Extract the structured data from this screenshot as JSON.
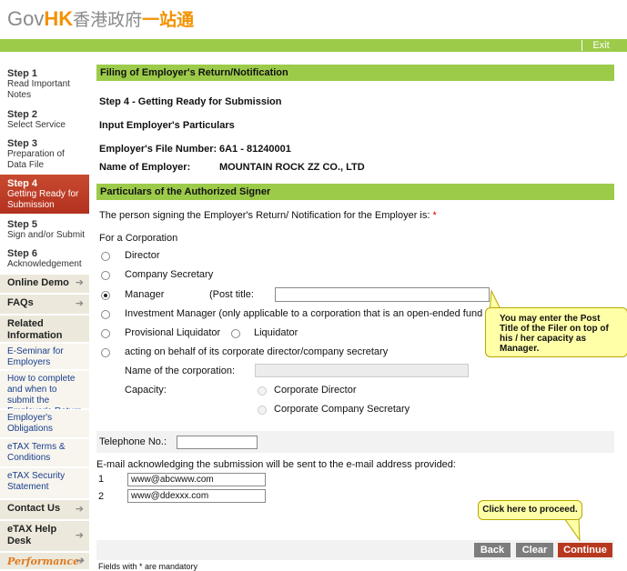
{
  "header": {
    "logo_gov": "Gov",
    "logo_hk": "HK",
    "logo_zh_grey": "香港政府",
    "logo_zh_orange": "一站通",
    "exit_label": "Exit"
  },
  "sidebar": {
    "steps": [
      {
        "num": "Step 1",
        "label": "Read Important Notes"
      },
      {
        "num": "Step 2",
        "label": "Select Service"
      },
      {
        "num": "Step 3",
        "label": "Preparation of Data File"
      },
      {
        "num": "Step 4",
        "label": "Getting Ready for Submission"
      },
      {
        "num": "Step 5",
        "label": "Sign and/or Submit"
      },
      {
        "num": "Step 6",
        "label": "Acknowledgement"
      }
    ],
    "online_demo": "Online Demo",
    "faqs": "FAQs",
    "related_information": "Related Information",
    "links": [
      "E-Seminar for Employers",
      "How to complete and when to submit the Employer's Return",
      "Employer's Obligations",
      "eTAX Terms & Conditions",
      "eTAX Security Statement"
    ],
    "contact_us": "Contact Us",
    "etax_help": "eTAX Help Desk",
    "performance": "Performance"
  },
  "main": {
    "section_title": "Filing of Employer's Return/Notification",
    "step_heading": "Step 4 - Getting Ready for Submission",
    "input_heading": "Input Employer's Particulars",
    "file_number_label": "Employer's File Number:",
    "file_number_value": "6A1 - 81240001",
    "employer_name_label": "Name of Employer:",
    "employer_name_value": "MOUNTAIN ROCK ZZ CO., LTD",
    "signer_section_title": "Particulars of the Authorized Signer",
    "signer_intro": "The person signing the Employer's Return/ Notification for the Employer is:",
    "required_mark": "*",
    "for_corporation": "For a Corporation",
    "options": {
      "director": "Director",
      "company_secretary": "Company Secretary",
      "manager": "Manager",
      "post_title_label": "(Post title:",
      "post_title_value": "",
      "investment_manager": "Investment Manager (only applicable to a corporation that is an open-ended fund co",
      "provisional_liquidator": "Provisional Liquidator",
      "liquidator": "Liquidator",
      "acting_on_behalf": "acting on behalf of its corporate director/company secretary",
      "selected": "manager"
    },
    "corporation_name_label": "Name of the corporation:",
    "corporation_name_value": "",
    "capacity_label": "Capacity:",
    "capacity_options": [
      "Corporate Director",
      "Corporate Company Secretary"
    ],
    "telephone_label": "Telephone No.:",
    "telephone_value": "",
    "email_intro": "E-mail acknowledging the submission will be sent to the e-mail address provided:",
    "emails": [
      {
        "num": "1",
        "value": "www@abcwww.com"
      },
      {
        "num": "2",
        "value": "www@ddexxx.com"
      }
    ],
    "footnote": "Fields with * are mandatory"
  },
  "tooltips": {
    "post_title_tip": "You may enter the Post Title of the Filer on top of his / her capacity as Manager.",
    "proceed_tip": "Click here to proceed."
  },
  "buttons": {
    "back": "Back",
    "clear": "Clear",
    "continue": "Continue"
  },
  "colors": {
    "green_bar": "#9ccb4a",
    "current_step": "#c0392b",
    "continue_button": "#b8381f",
    "grey_button": "#7d7d7d",
    "tooltip_bg": "#ffffa8"
  }
}
